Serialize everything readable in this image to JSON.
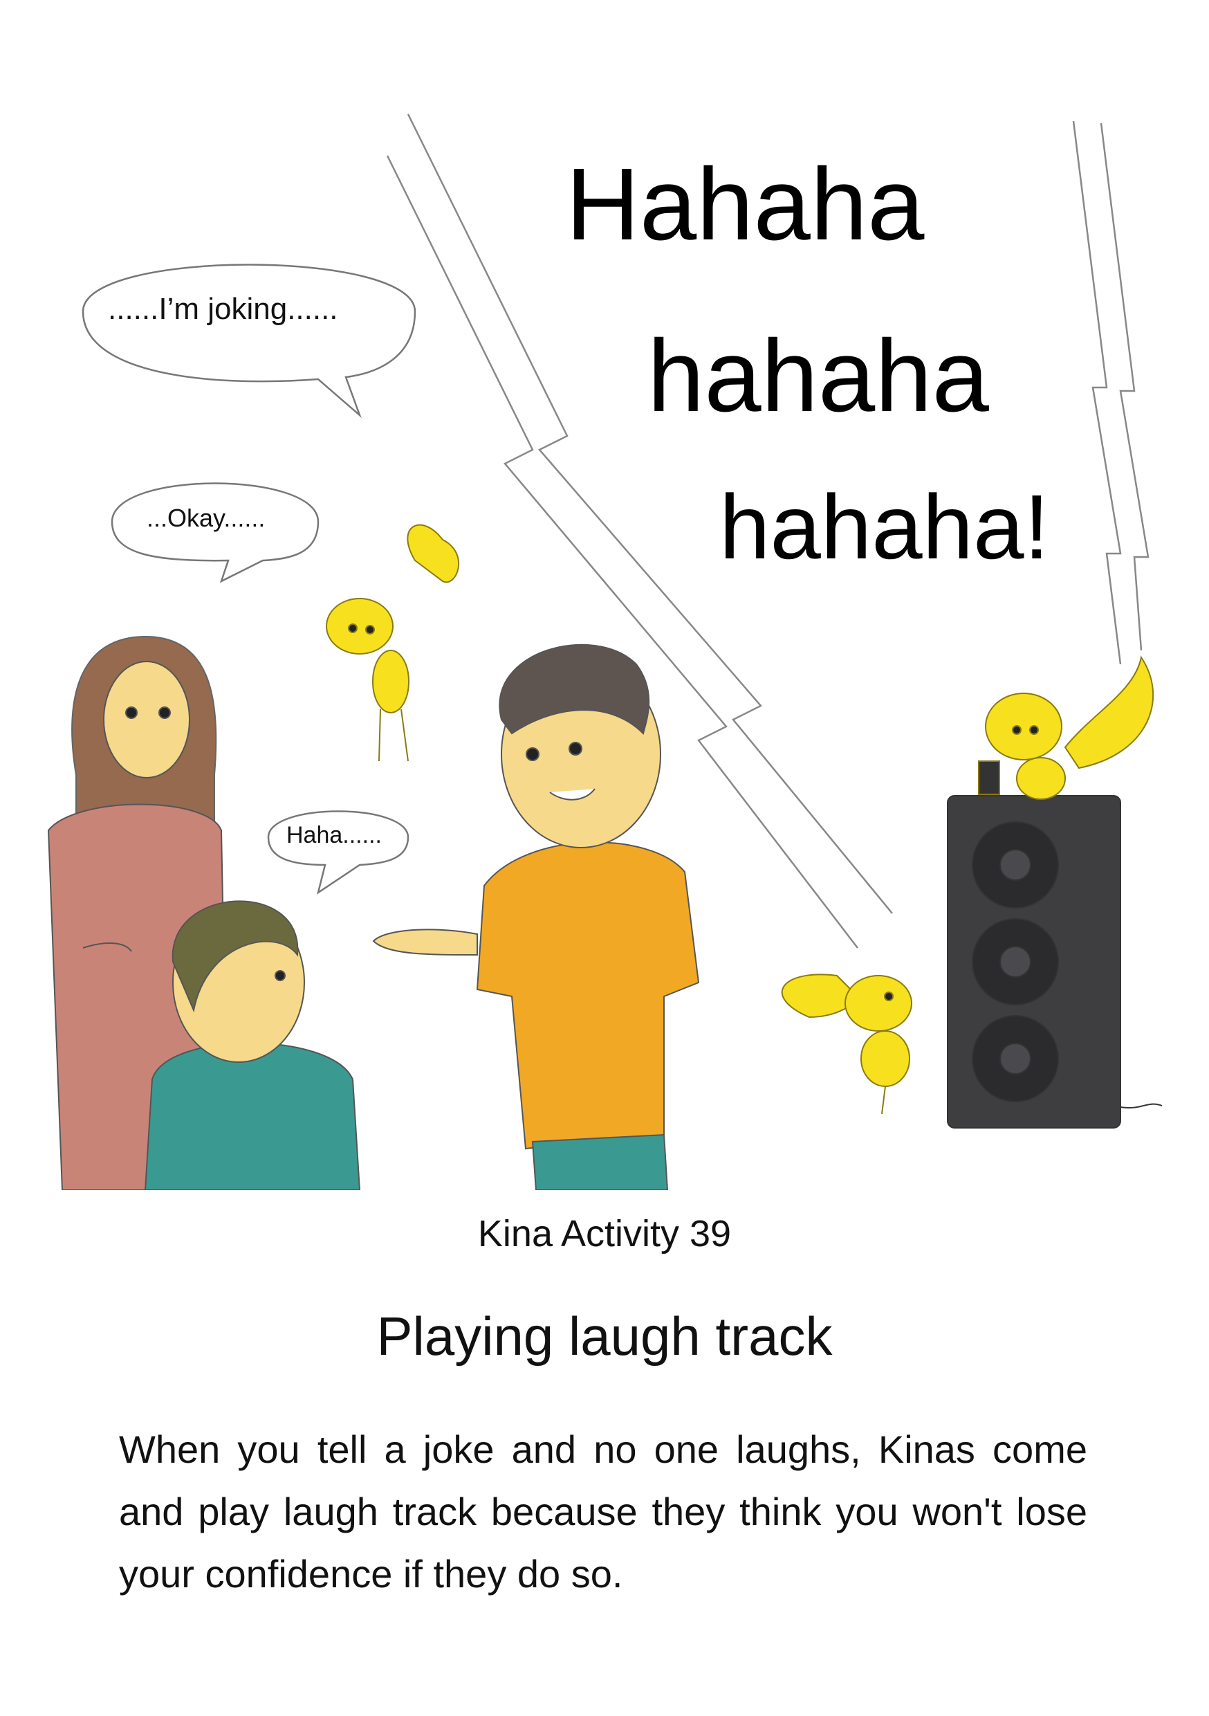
{
  "laugh_track": {
    "line1": "Hahaha",
    "line2": "hahaha",
    "line3": "hahaha!"
  },
  "speech_bubbles": {
    "father": "......I’m joking......",
    "mother": "...Okay......",
    "child": "Haha......"
  },
  "activity": {
    "number_label": "Kina Activity 39",
    "title": "Playing laugh track",
    "description": "When you tell a joke and no one laughs, Kinas come and play laugh track because they think you won't lose your confidence if they do so."
  },
  "colors": {
    "kina_yellow": "#f7e11e",
    "mother_dress": "#c98478",
    "mother_hair": "#8a5a3c",
    "father_shirt": "#f1a824",
    "father_hair": "#5f5550",
    "child_sweater": "#3a9a92",
    "child_hair": "#6b6a3e",
    "skin": "#f6d98a",
    "speaker": "#3e3e40"
  }
}
